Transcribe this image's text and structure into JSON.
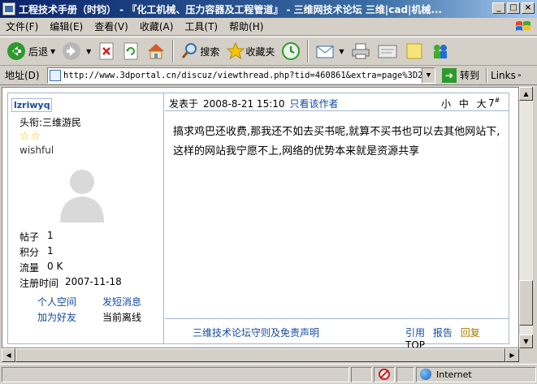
{
  "window": {
    "title": "工程技术手册（时钧） - 『化工机械、压力容器及工程管道』 - 三维网技术论坛 三维|cad|机械...",
    "minimize": "_",
    "maximize": "□",
    "close": "×"
  },
  "menu": [
    "文件(F)",
    "编辑(E)",
    "查看(V)",
    "收藏(A)",
    "工具(T)",
    "帮助(H)"
  ],
  "toolbar": {
    "back": "后退",
    "search": "搜索",
    "favorites": "收藏夹"
  },
  "address": {
    "label": "地址(D)",
    "url": "http://www.3dportal.cn/discuz/viewthread.php?tid=460861&extra=page%3D2",
    "go": "转到",
    "links": "Links"
  },
  "post": {
    "username": "lzriwyq",
    "rank": "头衔:三维游民",
    "stars": "☆☆",
    "tagline": "wishful",
    "stats": [
      {
        "label": "帖子",
        "value": "1"
      },
      {
        "label": "积分",
        "value": "1"
      },
      {
        "label": "流量",
        "value": "0 K"
      },
      {
        "label": "注册时间",
        "value": "2007-11-18"
      }
    ],
    "user_links": {
      "space": "个人空间",
      "pm": "发短消息",
      "add_friend": "加为好友",
      "status": "当前离线"
    },
    "posted_label": "发表于",
    "posted_time": "2008-8-21 15:10",
    "author_only": "只看该作者",
    "font_sizes": "小 中 大",
    "floor": "7",
    "floor_mark": "#",
    "message": "搞求鸡巴还收费,那我还不如去买书呢,就算不买书也可以去其他网站下,这样的网站我宁愿不上,网络的优势本来就是资源共享",
    "rules": "三维技术论坛守则及免责声明",
    "actions": {
      "quote": "引用",
      "report": "报告",
      "reply": "回复",
      "top": "TOP"
    }
  },
  "status": {
    "zone": "Internet"
  }
}
